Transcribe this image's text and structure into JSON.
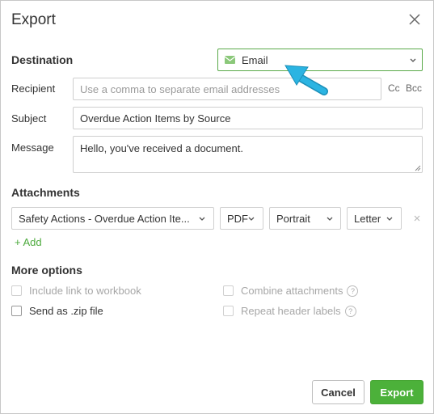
{
  "dialog": {
    "title": "Export",
    "close_icon": "close-icon"
  },
  "destination": {
    "heading": "Destination",
    "selected": "Email",
    "icon": "envelope-icon"
  },
  "recipient": {
    "label": "Recipient",
    "placeholder": "Use a comma to separate email addresses",
    "cc_label": "Cc",
    "bcc_label": "Bcc"
  },
  "subject": {
    "label": "Subject",
    "value": "Overdue Action Items by Source"
  },
  "message": {
    "label": "Message",
    "value": "Hello, you've received a document."
  },
  "attachments": {
    "heading": "Attachments",
    "item": {
      "name": "Safety Actions - Overdue Action Ite...",
      "format": "PDF",
      "orientation": "Portrait",
      "paper": "Letter"
    },
    "add_label": "+ Add"
  },
  "more_options": {
    "heading": "More options",
    "include_link": "Include link to workbook",
    "combine": "Combine attachments",
    "send_zip": "Send as .zip file",
    "repeat_headers": "Repeat header labels"
  },
  "buttons": {
    "cancel": "Cancel",
    "export": "Export"
  },
  "colors": {
    "accent_green": "#4cb13a",
    "pointer_blue": "#1fa8d6"
  }
}
